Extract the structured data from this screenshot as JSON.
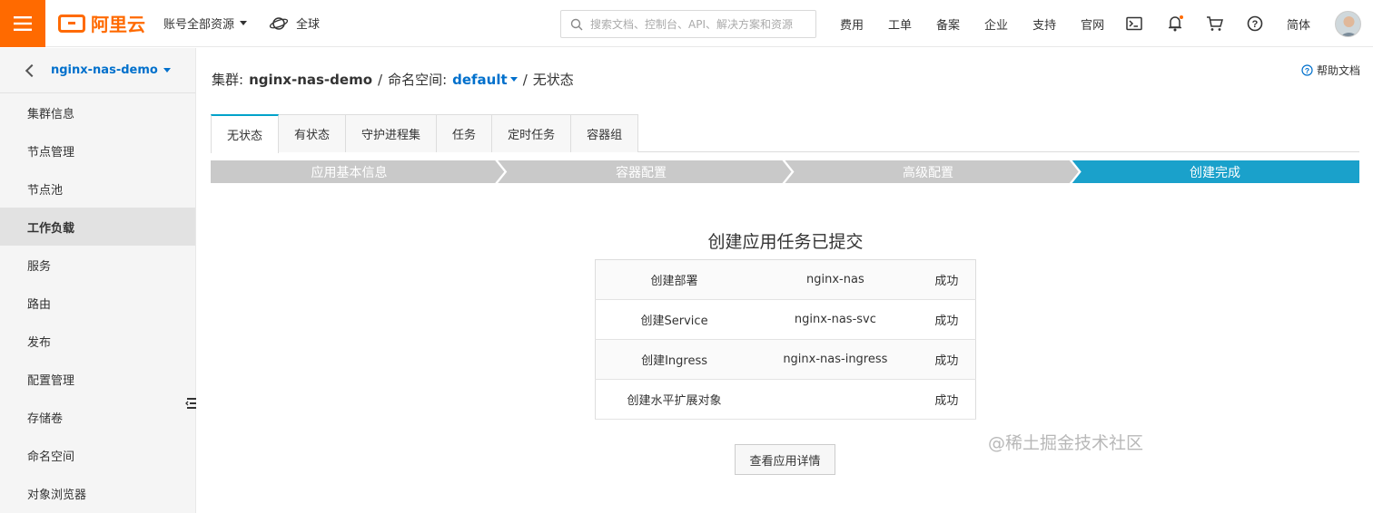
{
  "header": {
    "brand": "阿里云",
    "account_scope": "账号全部资源",
    "region": "全球",
    "search_placeholder": "搜索文档、控制台、API、解决方案和资源",
    "nav_links": [
      "费用",
      "工单",
      "备案",
      "企业",
      "支持",
      "官网"
    ],
    "language": "简体",
    "accent_color": "#ff6a00"
  },
  "sidebar": {
    "cluster_name": "nginx-nas-demo",
    "items": [
      {
        "label": "集群信息"
      },
      {
        "label": "节点管理"
      },
      {
        "label": "节点池"
      },
      {
        "label": "工作负载",
        "active": true
      },
      {
        "label": "服务"
      },
      {
        "label": "路由"
      },
      {
        "label": "发布"
      },
      {
        "label": "配置管理"
      },
      {
        "label": "存储卷"
      },
      {
        "label": "命名空间"
      },
      {
        "label": "对象浏览器"
      }
    ]
  },
  "main": {
    "breadcrumb": {
      "cluster_label": "集群:",
      "cluster_name": "nginx-nas-demo",
      "sep1": "/",
      "namespace_label": "命名空间:",
      "namespace": "default",
      "sep2": "/",
      "current": "无状态"
    },
    "help_link": "帮助文档",
    "tabs": [
      {
        "label": "无状态",
        "active": true
      },
      {
        "label": "有状态"
      },
      {
        "label": "守护进程集"
      },
      {
        "label": "任务"
      },
      {
        "label": "定时任务"
      },
      {
        "label": "容器组"
      }
    ],
    "steps": {
      "items": [
        "应用基本信息",
        "容器配置",
        "高级配置",
        "创建完成"
      ],
      "current_index": 3,
      "active_color": "#1aa1cb",
      "inactive_color": "#c9c9c9"
    },
    "result": {
      "title": "创建应用任务已提交",
      "rows": [
        {
          "action": "创建部署",
          "name": "nginx-nas",
          "status": "成功"
        },
        {
          "action": "创建Service",
          "name": "nginx-nas-svc",
          "status": "成功"
        },
        {
          "action": "创建Ingress",
          "name": "nginx-nas-ingress",
          "status": "成功"
        },
        {
          "action": "创建水平扩展对象",
          "name": "",
          "status": "成功"
        }
      ],
      "detail_button": "查看应用详情"
    },
    "watermark": "@稀土掘金技术社区"
  }
}
